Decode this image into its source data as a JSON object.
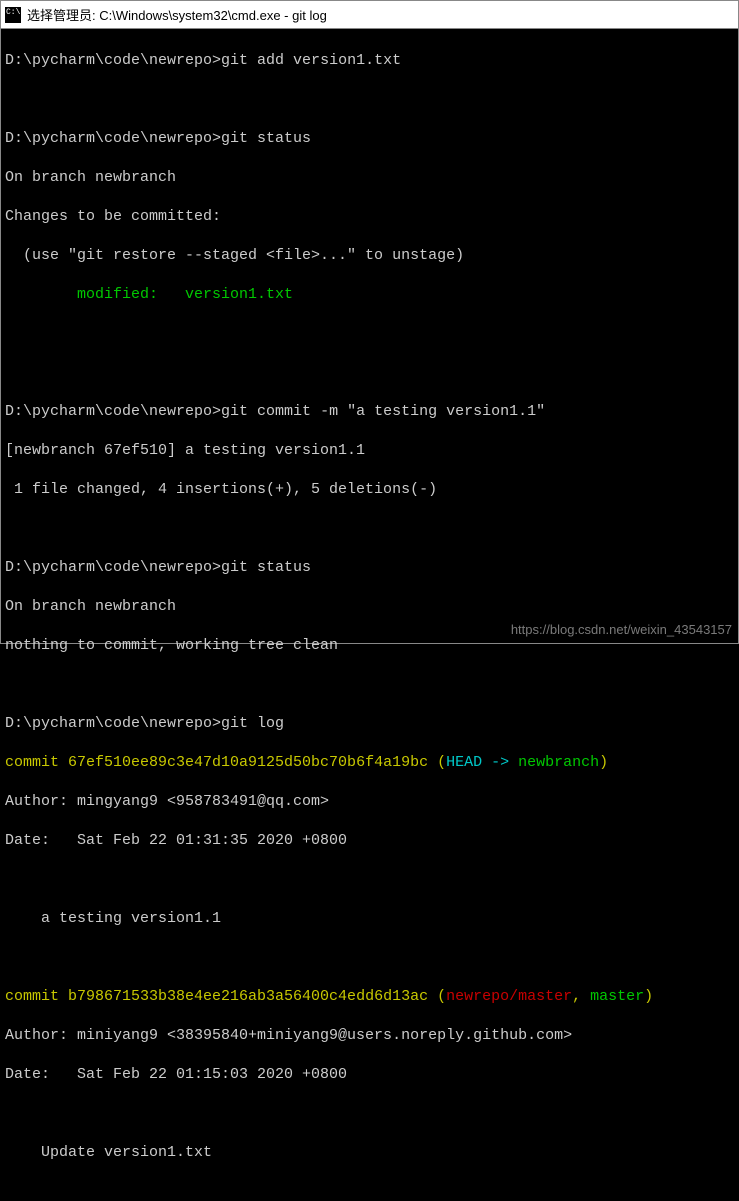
{
  "titlebar": {
    "text": "选择管理员: C:\\Windows\\system32\\cmd.exe - git  log"
  },
  "prompt": "D:\\pycharm\\code\\newrepo>",
  "cmd1": "git add version1.txt",
  "cmd2": "git status",
  "status1_branch": "On branch newbranch",
  "status1_changes": "Changes to be committed:",
  "status1_hint": "  (use \"git restore --staged <file>...\" to unstage)",
  "status1_modified": "        modified:   version1.txt",
  "cmd3": "git commit -m \"a testing version1.1\"",
  "commit_summary": "[newbranch 67ef510] a testing version1.1",
  "commit_stats": " 1 file changed, 4 insertions(+), 5 deletions(-)",
  "cmd4": "git status",
  "status2_branch": "On branch newbranch",
  "status2_clean": "nothing to commit, working tree clean",
  "cmd5": "git log",
  "log1_commit_prefix": "commit ",
  "log1_hash": "67ef510ee89c3e47d10a9125d50bc70b6f4a19bc",
  "log1_refs_open": " (",
  "log1_head": "HEAD -> ",
  "log1_branch": "newbranch",
  "log1_refs_close": ")",
  "log1_author": "Author: mingyang9 <958783491@qq.com>",
  "log1_date": "Date:   Sat Feb 22 01:31:35 2020 +0800",
  "log1_msg": "    a testing version1.1",
  "log2_commit_prefix": "commit ",
  "log2_hash": "b798671533b38e4ee216ab3a56400c4edd6d13ac",
  "log2_refs_open": " (",
  "log2_remote": "newrepo/master",
  "log2_comma": ", ",
  "log2_master": "master",
  "log2_refs_close": ")",
  "log2_author": "Author: miniyang9 <38395840+miniyang9@users.noreply.github.com>",
  "log2_date": "Date:   Sat Feb 22 01:15:03 2020 +0800",
  "log2_msg": "    Update version1.txt",
  "watermark": "https://blog.csdn.net/weixin_43543157"
}
